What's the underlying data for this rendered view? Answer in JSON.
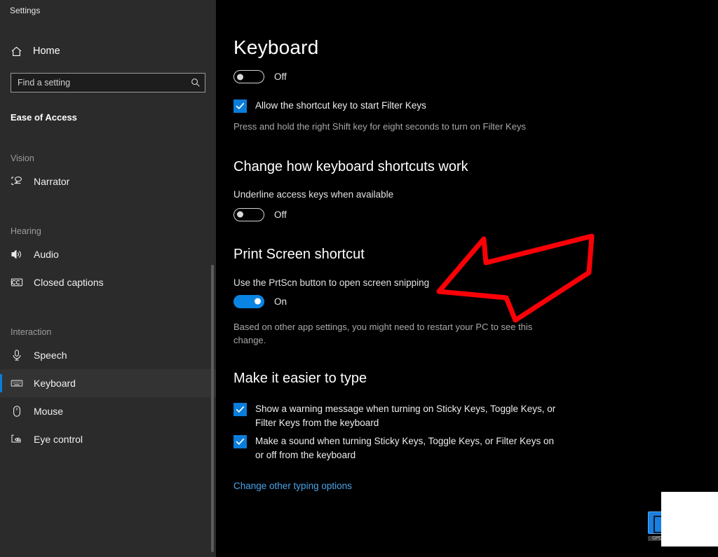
{
  "window": {
    "title": "Settings"
  },
  "sidebar": {
    "home": {
      "label": "Home",
      "icon": "home-icon"
    },
    "search": {
      "placeholder": "Find a setting",
      "value": "",
      "icon": "search-icon"
    },
    "category": "Ease of Access",
    "groups": [
      {
        "label": "Vision",
        "items": [
          {
            "label": "Narrator",
            "icon": "narrator-icon",
            "selected": false
          }
        ]
      },
      {
        "label": "Hearing",
        "items": [
          {
            "label": "Audio",
            "icon": "audio-speaker-icon",
            "selected": false
          },
          {
            "label": "Closed captions",
            "icon": "closed-captions-icon",
            "selected": false
          }
        ]
      },
      {
        "label": "Interaction",
        "items": [
          {
            "label": "Speech",
            "icon": "microphone-icon",
            "selected": false
          },
          {
            "label": "Keyboard",
            "icon": "keyboard-icon",
            "selected": true
          },
          {
            "label": "Mouse",
            "icon": "mouse-icon",
            "selected": false
          },
          {
            "label": "Eye control",
            "icon": "eye-control-icon",
            "selected": false
          }
        ]
      }
    ]
  },
  "main": {
    "page_title": "Keyboard",
    "filter_keys": {
      "toggle_state": "Off",
      "toggle_on": false,
      "checkbox_label": "Allow the shortcut key to start Filter Keys",
      "checkbox_checked": true,
      "description": "Press and hold the right Shift key for eight seconds to turn on Filter Keys"
    },
    "shortcuts_section": {
      "heading": "Change how keyboard shortcuts work",
      "setting_label": "Underline access keys when available",
      "toggle_state": "Off",
      "toggle_on": false
    },
    "print_screen_section": {
      "heading": "Print Screen shortcut",
      "setting_label": "Use the PrtScn button to open screen snipping",
      "toggle_state": "On",
      "toggle_on": true,
      "note": "Based on other app settings, you might need to restart your PC to see this change."
    },
    "easier_to_type_section": {
      "heading": "Make it easier to type",
      "checkboxes": [
        {
          "label": "Show a warning message when turning on Sticky Keys, Toggle Keys, or Filter Keys from the keyboard",
          "checked": true
        },
        {
          "label": "Make a sound when turning Sticky Keys, Toggle Keys, or Filter Keys on or off from the keyboard",
          "checked": true
        }
      ],
      "link": "Change other typing options"
    }
  },
  "annotation": {
    "arrow": {
      "direction": "left",
      "color": "#fb0007",
      "style": "outline"
    }
  },
  "overlay": {
    "taskbar_icon_caption": "GPD"
  },
  "colors": {
    "accent": "#0a7ddb",
    "toggle_on": "#0a84e2",
    "link": "#4aa3e8",
    "sidebar_bg": "#2b2b2b",
    "content_bg": "#000000",
    "annotation_red": "#fb0007"
  }
}
